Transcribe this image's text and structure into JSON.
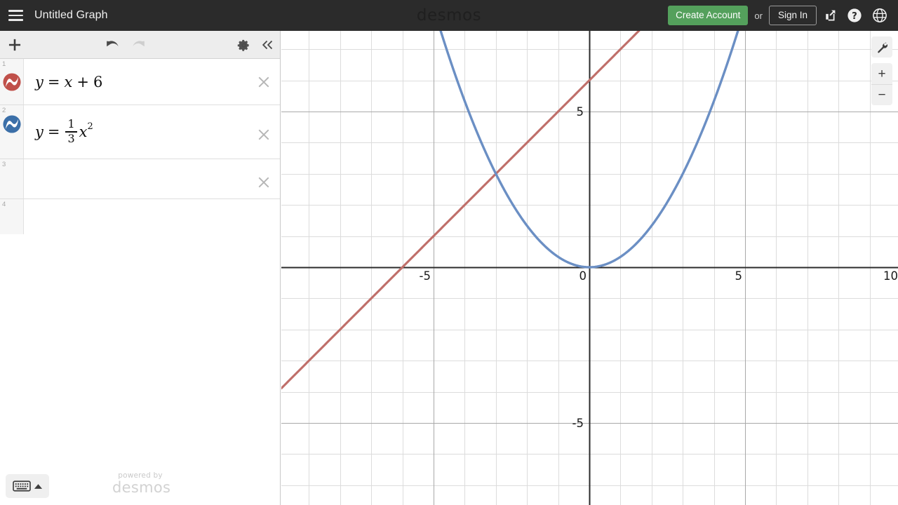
{
  "header": {
    "menu_icon": "hamburger-icon",
    "title": "Untitled Graph",
    "wordmark": "desmos",
    "create_account_label": "Create Account",
    "or_label": "or",
    "sign_in_label": "Sign In",
    "share_icon": "share-icon",
    "help_icon": "help-question-icon",
    "language_icon": "globe-icon",
    "background_color": "#2b2b2b",
    "accent_green": "#54a05c"
  },
  "toolbar": {
    "add_icon": "plus-icon",
    "undo_icon": "undo-arrow-icon",
    "redo_icon": "redo-arrow-icon",
    "settings_icon": "gear-icon",
    "collapse_icon": "double-chevron-left-icon",
    "undo_enabled": true,
    "redo_enabled": false
  },
  "expressions": [
    {
      "index": "1",
      "color": "#c0504a",
      "icon": "curve-circle-icon",
      "lhs": "y",
      "eq": "=",
      "rhs_var": "x",
      "op": "+",
      "constant": "6",
      "kind": "linear"
    },
    {
      "index": "2",
      "color": "#3b6fa8",
      "icon": "curve-circle-icon",
      "lhs": "y",
      "eq": "=",
      "frac_num": "1",
      "frac_den": "3",
      "rhs_var": "x",
      "exponent": "2",
      "kind": "quadratic"
    },
    {
      "index": "3",
      "color": null,
      "icon": null,
      "kind": "empty"
    },
    {
      "index": "4",
      "color": null,
      "icon": null,
      "kind": "empty"
    }
  ],
  "delete_icon": "close-x-icon",
  "keyboard": {
    "keyboard_icon": "keyboard-icon",
    "caret_icon": "caret-up-icon"
  },
  "watermark": {
    "line1": "powered by",
    "line2": "desmos"
  },
  "graph_controls": {
    "tools_icon": "wrench-icon",
    "zoom_in_label": "+",
    "zoom_in_icon": "plus-icon",
    "zoom_out_label": "−",
    "zoom_out_icon": "minus-icon"
  },
  "chart_data": {
    "type": "line",
    "title": "Untitled Graph",
    "xlabel": "",
    "ylabel": "",
    "xlim": [
      -9.9,
      9.9
    ],
    "ylim": [
      -7.6,
      7.6
    ],
    "grid": true,
    "minor_grid_step": 1,
    "major_grid_step": 5,
    "x_tick_labels": [
      {
        "value": -5,
        "label": "-5"
      },
      {
        "value": 0,
        "label": "0"
      },
      {
        "value": 5,
        "label": "5"
      },
      {
        "value": 10,
        "label": "10"
      }
    ],
    "y_tick_labels": [
      {
        "value": 5,
        "label": "5"
      },
      {
        "value": 0,
        "label": "0"
      },
      {
        "value": -5,
        "label": "-5"
      }
    ],
    "axis_color": "#2b2b2b",
    "grid_color": "#d9d9d9",
    "major_grid_color": "#a8a8a8",
    "series": [
      {
        "name": "y = x + 6",
        "expression": "y = x + 6",
        "color": "#c0706b",
        "type": "line",
        "slope": 1,
        "intercept": 6,
        "linewidth": 3.2
      },
      {
        "name": "y = (1/3)x^2",
        "expression": "y = \\frac{1}{3}x^2",
        "color": "#6b8fc4",
        "type": "parabola",
        "coefficient": 0.3333333333,
        "vertex": [
          0,
          0
        ],
        "linewidth": 3.4
      }
    ]
  }
}
